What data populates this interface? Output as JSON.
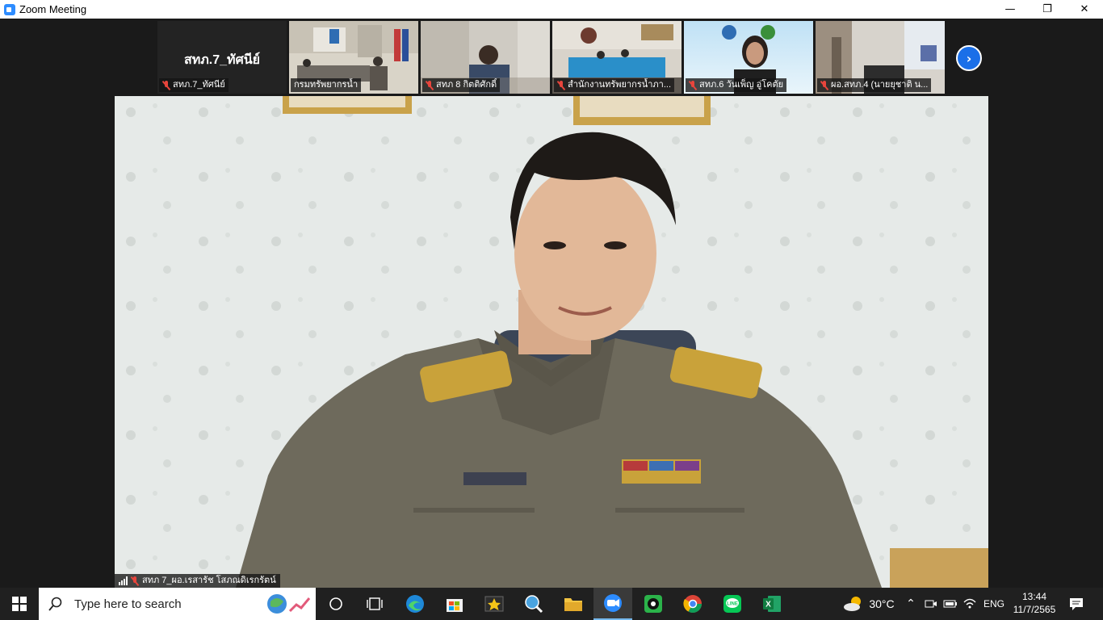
{
  "window": {
    "title": "Zoom Meeting",
    "minimize_glyph": "—",
    "restore_glyph": "❐",
    "close_glyph": "✕"
  },
  "gallery": {
    "self_tile": {
      "display_name": "สทภ.7_ทัศนีย์",
      "label": "สทภ.7_ทัศนีย์",
      "muted": true
    },
    "tiles": [
      {
        "label": "กรมทรัพยากรน้ำ",
        "muted": false
      },
      {
        "label": "สทภ 8 กิตติศักดิ์",
        "muted": true
      },
      {
        "label": "สำนักงานทรัพยากรน้ำภา...",
        "muted": true
      },
      {
        "label": "สทภ.6 วันเพ็ญ อู่โคตัย",
        "muted": true
      },
      {
        "label": "ผอ.สทภ.4 (นายยุชาติ น...",
        "muted": true
      }
    ],
    "next_icon": "chevron-right-icon"
  },
  "main_video": {
    "speaker_label": "สทภ 7_ผอ.เรสารัช โสภณดิเรกรัตน์",
    "muted": true
  },
  "taskbar": {
    "search_placeholder": "Type here to search",
    "pinned": [
      "chrome-icon",
      "edge-icon",
      "store-icon",
      "movie-star-icon",
      "search-globe-icon",
      "file-explorer-icon",
      "zoom-icon",
      "obs-icon",
      "chrome-alt-icon",
      "line-icon",
      "excel-icon"
    ],
    "weather_temp": "30°C",
    "language": "ENG",
    "time": "13:44",
    "date": "11/7/2565"
  }
}
